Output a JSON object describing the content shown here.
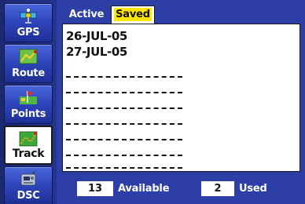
{
  "sidebar": {
    "items": [
      {
        "label": "GPS",
        "icon": "satellite-icon"
      },
      {
        "label": "Route",
        "icon": "route-map-icon"
      },
      {
        "label": "Points",
        "icon": "waypoint-flag-icon"
      },
      {
        "label": "Track",
        "icon": "track-icon",
        "selected": true
      },
      {
        "label": "DSC",
        "icon": "dsc-radio-icon"
      }
    ]
  },
  "tabs": {
    "active_label": "Active",
    "saved_label": "Saved",
    "selected": "Saved"
  },
  "saved_tracks": [
    "26-JUL-05",
    "27-JUL-05",
    "------------",
    "------------",
    "------------",
    "------------",
    "------------",
    "------------",
    "------------"
  ],
  "footer": {
    "available_count": "13",
    "available_label": "Available",
    "used_count": "2",
    "used_label": "Used"
  },
  "colors": {
    "background": "#2d3ea6",
    "selected_tab_highlight": "#ffe600",
    "panel": "#ffffff"
  }
}
